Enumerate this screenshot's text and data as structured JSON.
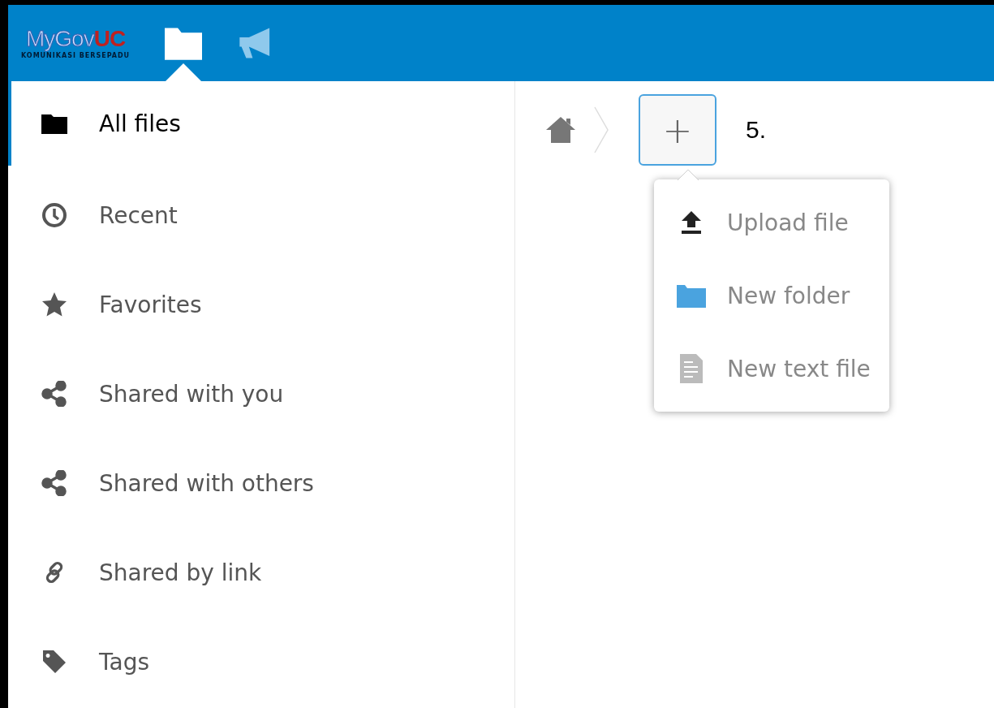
{
  "header": {
    "logo": {
      "text": "MyGov",
      "accent": "UC",
      "tagline": "KOMUNIKASI BERSEPADU"
    },
    "apps": [
      {
        "kind": "files",
        "selected": true
      },
      {
        "kind": "activity",
        "selected": false
      }
    ]
  },
  "sidebar": {
    "items": [
      {
        "kind": "folder",
        "label": "All files",
        "selected": true
      },
      {
        "kind": "clock",
        "label": "Recent",
        "selected": false
      },
      {
        "kind": "star",
        "label": "Favorites",
        "selected": false
      },
      {
        "kind": "share",
        "label": "Shared with you",
        "selected": false
      },
      {
        "kind": "share",
        "label": "Shared with others",
        "selected": false
      },
      {
        "kind": "link",
        "label": "Shared by link",
        "selected": false
      },
      {
        "kind": "tag",
        "label": "Tags",
        "selected": false
      }
    ]
  },
  "breadcrumb": {
    "new_button": "+",
    "annotation": "5."
  },
  "new_menu": {
    "items": [
      {
        "kind": "upload",
        "label": "Upload file"
      },
      {
        "kind": "folder",
        "label": "New folder"
      },
      {
        "kind": "text",
        "label": "New text file"
      }
    ]
  }
}
